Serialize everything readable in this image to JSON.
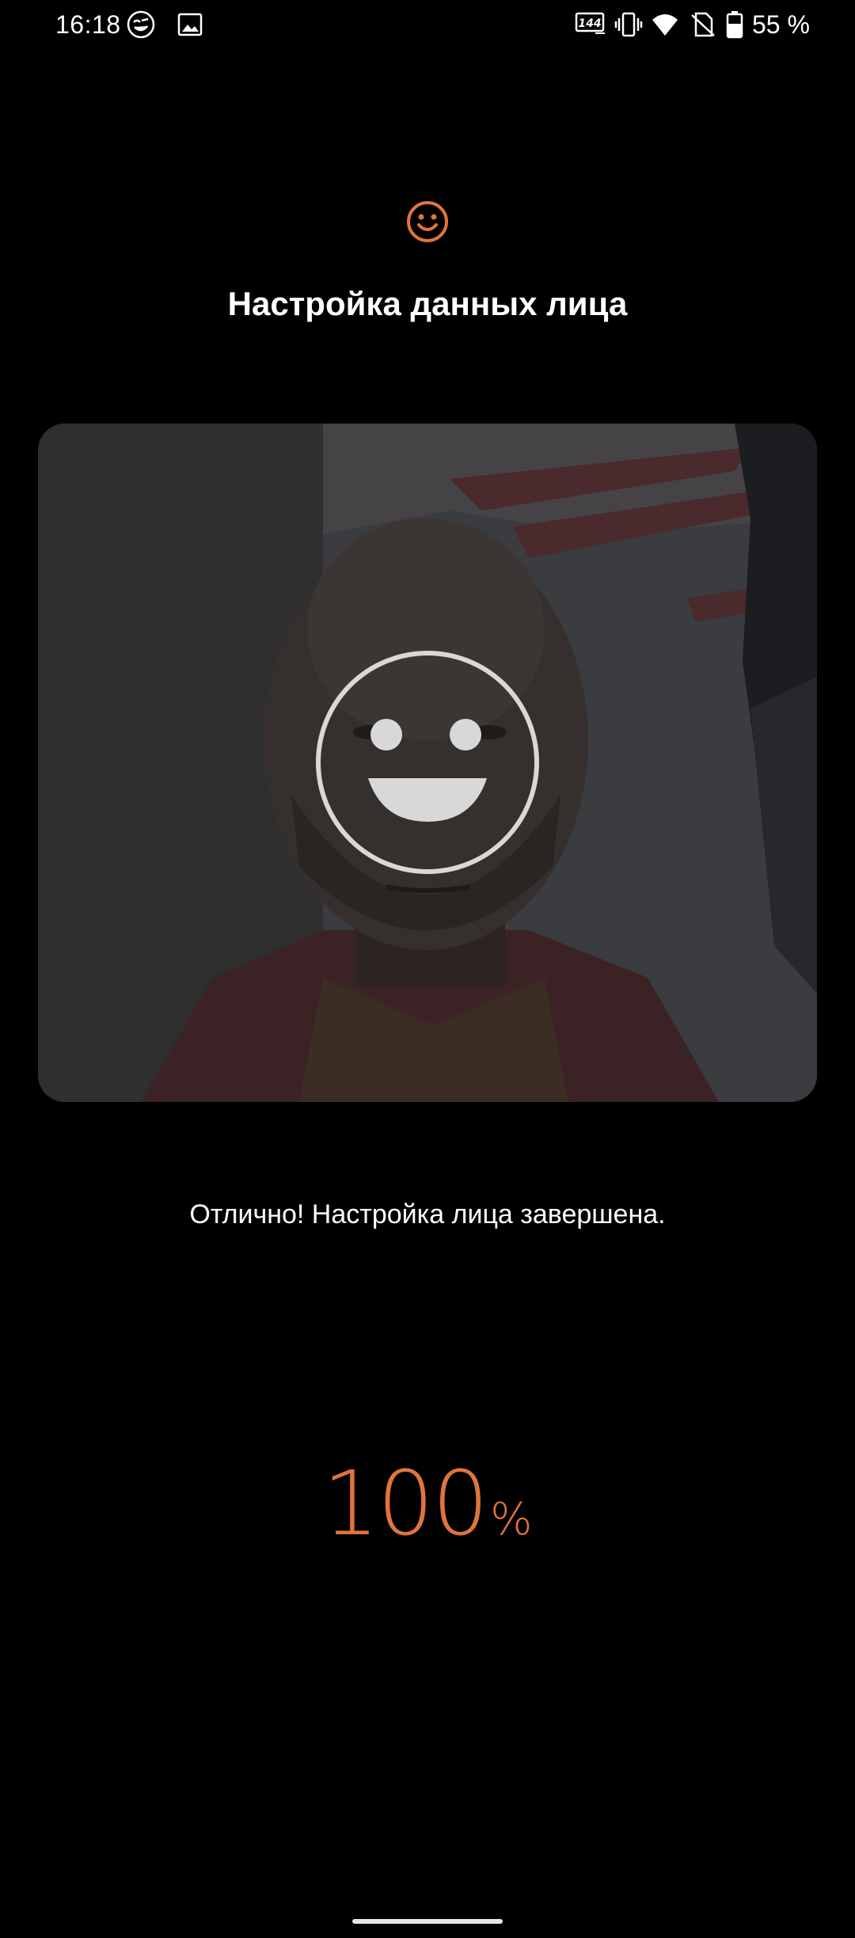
{
  "status_bar": {
    "time": "16:18",
    "icons_left": [
      "game-genie-icon",
      "image-notification-icon"
    ],
    "icons_right": [
      "refresh-rate-144hz-icon",
      "vibrate-icon",
      "wifi-icon",
      "no-sim-icon",
      "battery-icon"
    ],
    "refresh_rate_label": "144",
    "battery_text": "55 %"
  },
  "header": {
    "icon": "smiley-face-icon",
    "title": "Настройка данных лица"
  },
  "camera": {
    "overlay_icon": "face-guide-smiley-icon"
  },
  "message": "Отлично! Настройка лица завершена.",
  "progress": {
    "value": "100",
    "unit": "%"
  },
  "colors": {
    "accent": "#e0743d",
    "background": "#000000",
    "text": "#ffffff"
  }
}
